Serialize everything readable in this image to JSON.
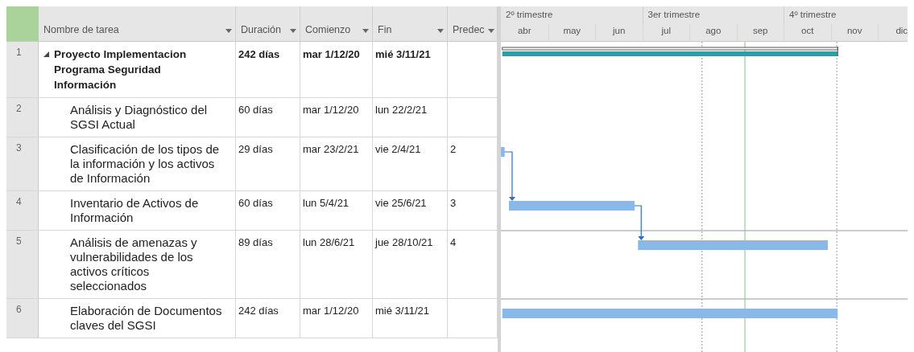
{
  "columns": [
    {
      "label": "Nombre de tarea"
    },
    {
      "label": "Duración"
    },
    {
      "label": "Comienzo"
    },
    {
      "label": "Fin"
    },
    {
      "label": "Predec"
    }
  ],
  "timescale": {
    "quarters": [
      "2º trimestre",
      "3er trimestre",
      "4º trimestre"
    ],
    "months": [
      "abr",
      "may",
      "jun",
      "jul",
      "ago",
      "sep",
      "oct",
      "nov",
      "dic"
    ]
  },
  "tasks": [
    {
      "id": "1",
      "kind": "summary",
      "expanded": true,
      "name": "Proyecto Implementacion Programa Seguridad Información",
      "duration": "242 días",
      "start": "mar 1/12/20",
      "finish": "mié 3/11/21",
      "children": [
        {
          "id": "2",
          "kind": "task",
          "name": "Análisis y Diagnóstico del SGSI Actual",
          "duration": "60 días",
          "start": "mar 1/12/20",
          "finish": "lun 22/2/21"
        },
        {
          "id": "3",
          "kind": "task",
          "name": "Clasificación de los tipos de la información y los activos de Información",
          "duration": "29 días",
          "start": "mar 23/2/21",
          "finish": "vie 2/4/21",
          "predecessors": "2"
        },
        {
          "id": "4",
          "kind": "task",
          "name": "Inventario de Activos de Información",
          "duration": "60 días",
          "start": "lun 5/4/21",
          "finish": "vie 25/6/21",
          "predecessors": "3"
        },
        {
          "id": "5",
          "kind": "task",
          "name": "Análisis de amenazas y vulnerabilidades de los activos críticos seleccionados",
          "duration": "89 días",
          "start": "lun 28/6/21",
          "finish": "jue 28/10/21",
          "predecessors": "4"
        },
        {
          "id": "6",
          "kind": "task",
          "name": "Elaboración de Documentos claves del SGSI",
          "duration": "242 días",
          "start": "mar 1/12/20",
          "finish": "mié 3/11/21"
        }
      ]
    }
  ]
}
